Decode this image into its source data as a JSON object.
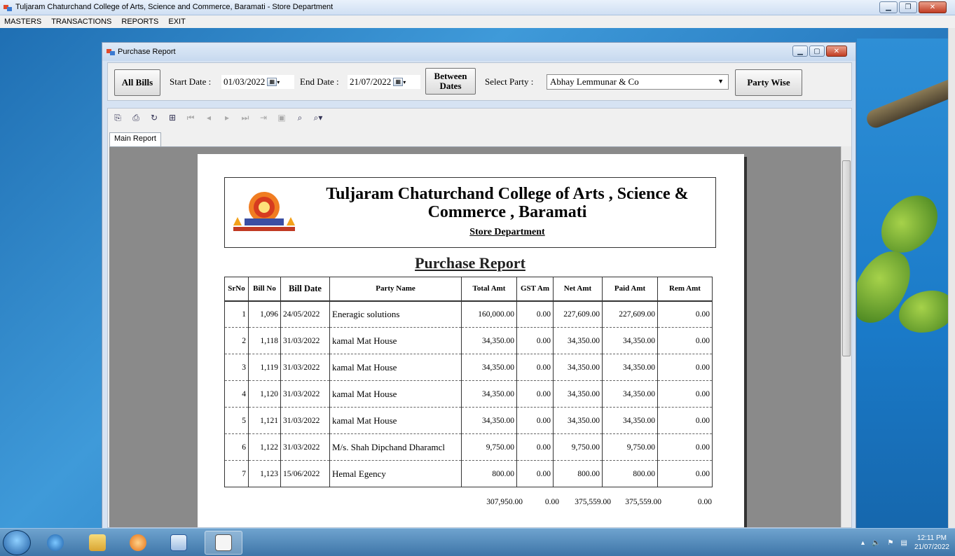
{
  "app": {
    "title": "Tuljaram Chaturchand College of Arts, Science and Commerce, Baramati - Store Department",
    "menu": [
      "MASTERS",
      "TRANSACTIONS",
      "REPORTS",
      "EXIT"
    ]
  },
  "child_window": {
    "title": "Purchase Report"
  },
  "filters": {
    "all_bills_label": "All Bills",
    "start_date_label": "Start Date :",
    "start_date": "01/03/2022",
    "end_date_label": "End Date :",
    "end_date": "21/07/2022",
    "between_dates_label": "Between Dates",
    "select_party_label": "Select Party :",
    "party": "Abhay Lemmunar & Co",
    "party_wise_label": "Party Wise"
  },
  "viewer": {
    "tab_label": "Main Report"
  },
  "report": {
    "college_line1": "Tuljaram Chaturchand College of Arts , Science &",
    "college_line2": "Commerce , Baramati",
    "department": "Store Department",
    "title": "Purchase Report",
    "columns": [
      "SrNo",
      "Bill No",
      "Bill Date",
      "Party Name",
      "Total Amt",
      "GST Am",
      "Net Amt",
      "Paid Amt",
      "Rem Amt"
    ],
    "rows": [
      [
        "1",
        "1,096",
        "24/05/2022",
        "Eneragic solutions",
        "160,000.00",
        "0.00",
        "227,609.00",
        "227,609.00",
        "0.00"
      ],
      [
        "2",
        "1,118",
        "31/03/2022",
        "kamal Mat House",
        "34,350.00",
        "0.00",
        "34,350.00",
        "34,350.00",
        "0.00"
      ],
      [
        "3",
        "1,119",
        "31/03/2022",
        "kamal Mat House",
        "34,350.00",
        "0.00",
        "34,350.00",
        "34,350.00",
        "0.00"
      ],
      [
        "4",
        "1,120",
        "31/03/2022",
        "kamal Mat House",
        "34,350.00",
        "0.00",
        "34,350.00",
        "34,350.00",
        "0.00"
      ],
      [
        "5",
        "1,121",
        "31/03/2022",
        "kamal Mat House",
        "34,350.00",
        "0.00",
        "34,350.00",
        "34,350.00",
        "0.00"
      ],
      [
        "6",
        "1,122",
        "31/03/2022",
        "M/s. Shah Dipchand Dharamcl",
        "9,750.00",
        "0.00",
        "9,750.00",
        "9,750.00",
        "0.00"
      ],
      [
        "7",
        "1,123",
        "15/06/2022",
        "Hemal Egency",
        "800.00",
        "0.00",
        "800.00",
        "800.00",
        "0.00"
      ]
    ],
    "totals": {
      "total_amt": "307,950.00",
      "gst_amt": "0.00",
      "net_amt": "375,559.00",
      "paid_amt": "375,559.00",
      "rem_amt": "0.00"
    }
  },
  "taskbar": {
    "time": "12:11 PM",
    "date": "21/07/2022"
  }
}
